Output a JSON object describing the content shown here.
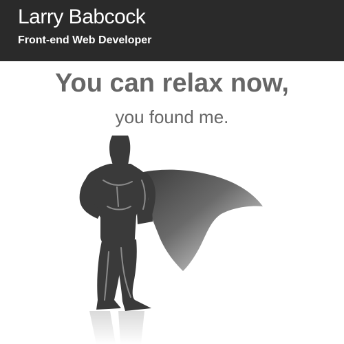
{
  "header": {
    "name": "Larry Babcock",
    "tagline": "Front-end Web Developer"
  },
  "main": {
    "headline": "You can relax now,",
    "subheadline": "you found me.",
    "illustration": "superhero-silhouette-icon"
  },
  "colors": {
    "header_bg": "#2a2a2a",
    "header_text": "#ffffff",
    "body_text": "#666666",
    "figure_dark": "#3a3a3a"
  }
}
